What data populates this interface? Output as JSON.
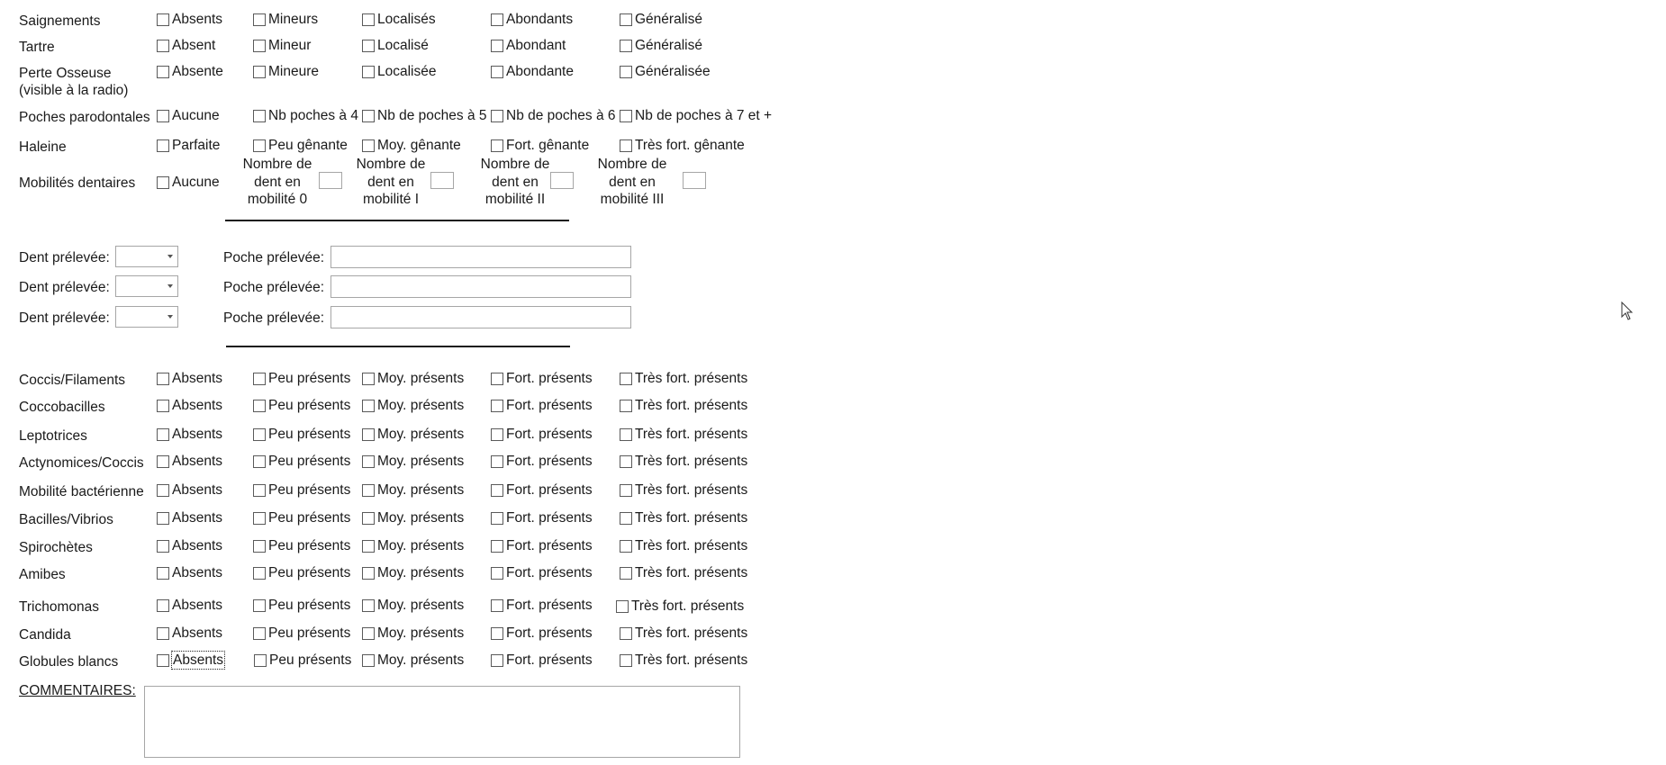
{
  "clinical": [
    {
      "label": [
        "Saignements"
      ],
      "options": [
        "Absents",
        "Mineurs",
        "Localisés",
        "Abondants",
        "Généralisé"
      ]
    },
    {
      "label": [
        "Tartre"
      ],
      "options": [
        "Absent",
        "Mineur",
        "Localisé",
        "Abondant",
        "Généralisé"
      ]
    },
    {
      "label": [
        "Perte Osseuse",
        "(visible à la radio)"
      ],
      "options": [
        "Absente",
        "Mineure",
        "Localisée",
        "Abondante",
        "Généralisée"
      ]
    },
    {
      "label": [
        "Poches parodontales"
      ],
      "options": [
        "Aucune",
        "Nb poches à 4",
        "Nb de poches à 5",
        "Nb de poches à 6",
        "Nb de poches à 7 et +"
      ]
    },
    {
      "label": [
        "Haleine"
      ],
      "options": [
        "Parfaite",
        "Peu gênante",
        "Moy. gênante",
        "Fort. gênante",
        "Très fort. gênante"
      ]
    }
  ],
  "mobility": {
    "label": "Mobilités dentaires",
    "none_option": "Aucune",
    "groups": [
      {
        "lines": [
          "Nombre de",
          "dent en",
          "mobilité 0"
        ]
      },
      {
        "lines": [
          "Nombre de",
          "dent en",
          "mobilité I"
        ]
      },
      {
        "lines": [
          "Nombre de",
          "dent en",
          "mobilité II"
        ]
      },
      {
        "lines": [
          "Nombre de",
          "dent en",
          "mobilité III"
        ]
      }
    ]
  },
  "samples": [
    {
      "dent_label": "Dent prélevée:",
      "poche_label": "Poche prélevée:"
    },
    {
      "dent_label": "Dent prélevée:",
      "poche_label": "Poche prélevée:"
    },
    {
      "dent_label": "Dent prélevée:",
      "poche_label": "Poche prélevée:"
    }
  ],
  "micro_options": [
    "Absents",
    "Peu présents",
    "Moy. présents",
    "Fort. présents",
    "Très fort. présents"
  ],
  "micro_rows": [
    {
      "label": "Coccis/Filaments"
    },
    {
      "label": "Coccobacilles"
    },
    {
      "label": "Leptotrices"
    },
    {
      "label": "Actynomices/Coccis"
    },
    {
      "label": "Mobilité bactérienne"
    },
    {
      "label": "Bacilles/Vibrios"
    },
    {
      "label": "Spirochètes"
    },
    {
      "label": "Amibes"
    },
    {
      "label": "Trichomonas"
    },
    {
      "label": "Candida"
    },
    {
      "label": "Globules blancs"
    }
  ],
  "comments": {
    "label": "COMMENTAIRES:",
    "value": ""
  }
}
